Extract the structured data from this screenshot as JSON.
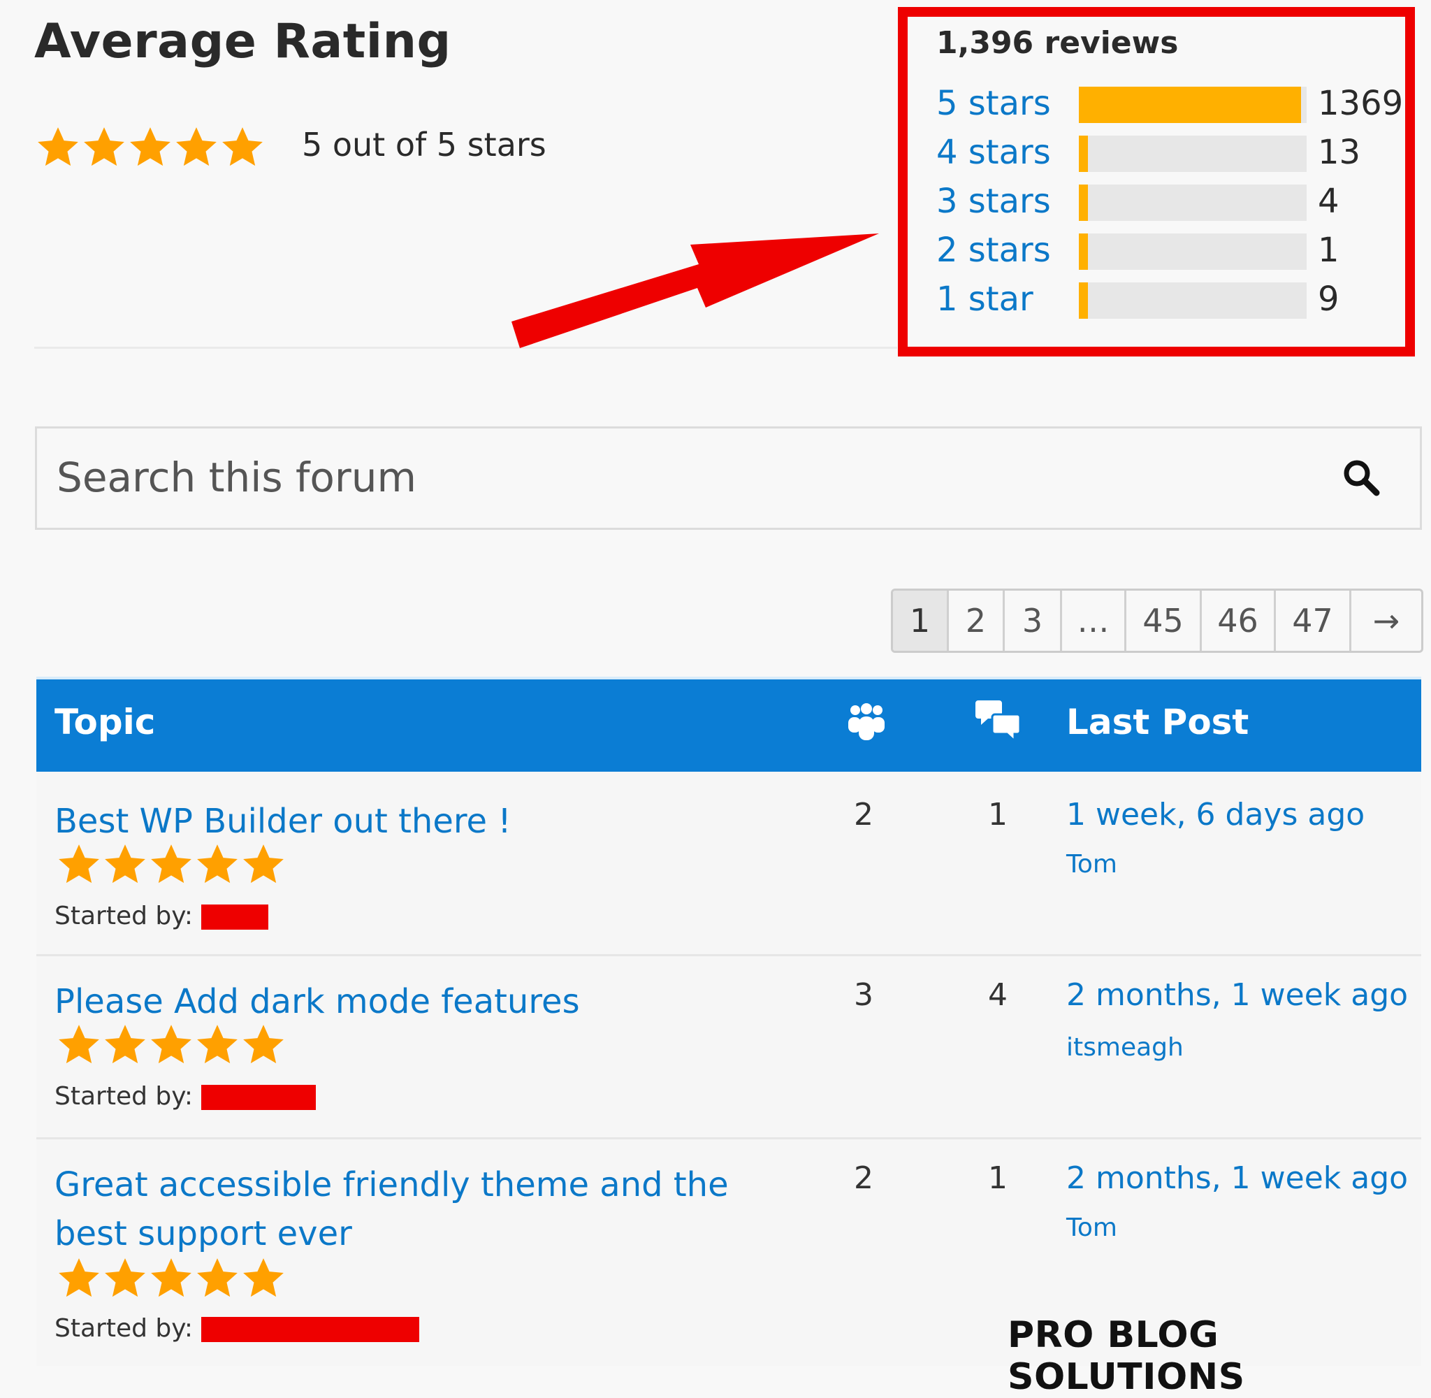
{
  "rating": {
    "title": "Average Rating",
    "summary": "5 out of 5 stars",
    "stars": 5,
    "star_color": "#ffa000"
  },
  "reviews": {
    "total_label": "1,396 reviews",
    "rows": [
      {
        "label": "5 stars",
        "count": "1369",
        "share": 0.981
      },
      {
        "label": "4 stars",
        "count": "13",
        "share": 0.009
      },
      {
        "label": "3 stars",
        "count": "4",
        "share": 0.003
      },
      {
        "label": "2 stars",
        "count": "1",
        "share": 0.001
      },
      {
        "label": "1 star",
        "count": "9",
        "share": 0.006
      }
    ],
    "bar_color": "#ffb000"
  },
  "annotation": {
    "color": "#ee0000"
  },
  "search": {
    "placeholder": "Search this forum"
  },
  "pagination": {
    "pages": [
      "1",
      "2",
      "3",
      "…",
      "45",
      "46",
      "47",
      "→"
    ],
    "current": "1"
  },
  "table": {
    "header_color": "#0b7dd4",
    "headers": {
      "topic": "Topic",
      "voices_icon": "users-icon",
      "replies_icon": "chat-bubbles-icon",
      "last_post": "Last Post"
    },
    "started_by_label": "Started by:",
    "rows": [
      {
        "title": "Best WP Builder out there !",
        "stars": 5,
        "voices": "2",
        "replies": "1",
        "last_post_time": "1 week, 6 days ago",
        "last_post_author": "Tom"
      },
      {
        "title": "Please Add dark mode features",
        "stars": 5,
        "voices": "3",
        "replies": "4",
        "last_post_time": "2 months, 1 week ago",
        "last_post_author": "itsmeagh"
      },
      {
        "title": "Great accessible friendly theme and the best support ever",
        "stars": 5,
        "voices": "2",
        "replies": "1",
        "last_post_time": "2 months, 1 week ago",
        "last_post_author": "Tom"
      }
    ]
  },
  "watermark": "PRO BLOG SOLUTIONS"
}
